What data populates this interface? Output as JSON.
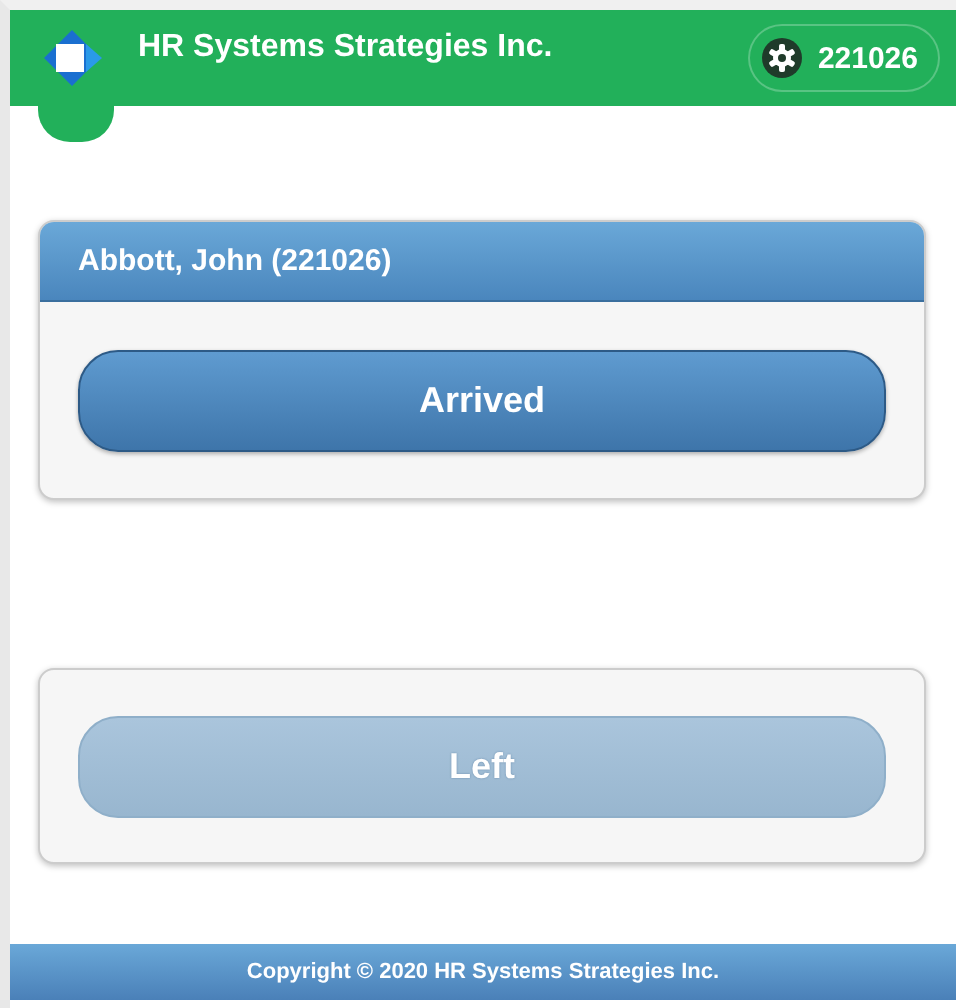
{
  "header": {
    "title": "HR Systems Strategies Inc.",
    "user_badge": "221026"
  },
  "employee_card": {
    "title": "Abbott, John (221026)",
    "button": {
      "label": "Arrived",
      "disabled": false
    }
  },
  "second_card": {
    "button": {
      "label": "Left",
      "disabled": true
    }
  },
  "footer": {
    "text": "Copyright © 2020 HR Systems Strategies Inc."
  }
}
